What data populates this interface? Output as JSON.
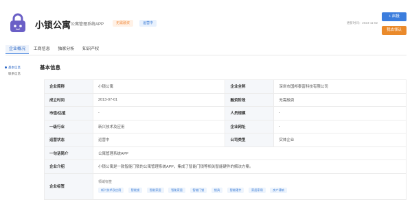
{
  "header": {
    "app_name": "小锁公寓",
    "description": "公寓管理系统APP",
    "tags": {
      "funding": "无需融资",
      "status": "运营中"
    },
    "update_time": "更新时间：2024-11-02",
    "buttons": {
      "follow": "+ 启投",
      "claim": "我去领认"
    },
    "logo_color": "#6a5fc6"
  },
  "tabs": [
    {
      "label": "企业概况",
      "active": true
    },
    {
      "label": "工商信息",
      "active": false
    },
    {
      "label": "独家分析",
      "active": false
    },
    {
      "label": "知识产权",
      "active": false
    }
  ],
  "side_nav": [
    {
      "label": "基本信息",
      "active": true
    },
    {
      "label": "联系信息",
      "active": false
    }
  ],
  "section_title": "基本信息",
  "info": {
    "short_name_label": "企业简称",
    "short_name": "小锁公寓",
    "full_name_label": "企业全称",
    "full_name": "深圳市国邦泰富科技有限公司",
    "founded_label": "成立时间",
    "founded": "2013-07-01",
    "stage_label": "融资阶段",
    "stage": "无需融资",
    "valuation_label": "市值/估值",
    "valuation": "-",
    "staff_label": "人员规模",
    "staff": "-",
    "industry_label": "一级行业",
    "industry": "新兴技术及应用",
    "website_label": "企业网址",
    "website": "-",
    "op_status_label": "运营状态",
    "op_status": "运营中",
    "company_type_label": "公司类型",
    "company_type": "实体企业",
    "slogan_label": "一句话简介",
    "slogan": "公寓管理系统APP",
    "intro_label": "企业介绍",
    "intro": "小锁公寓是一款智能门锁的公寓管理系统APP，集成了智能门锁等相关智能硬件的解决方案。",
    "tags_label": "企业标签",
    "tags_title": "领域标签",
    "tags": [
      "新兴技术及应用",
      "智能锁",
      "智能家居",
      "智能家居",
      "智能门锁",
      "锁具",
      "智能硬件",
      "家居家用",
      "房产建筑"
    ]
  }
}
